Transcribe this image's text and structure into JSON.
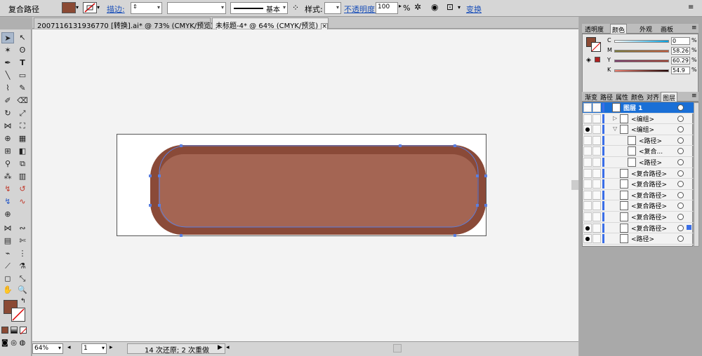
{
  "control_bar": {
    "object_type": "复合路径",
    "fill_color": "#8b4a34",
    "stroke_label": "描边:",
    "stroke_weight": "",
    "stroke_profile_label": "基本",
    "style_label": "样式:",
    "opacity_label": "不透明度:",
    "opacity_value": "100",
    "opacity_unit": "%",
    "transform_label": "变换"
  },
  "tabs": [
    {
      "title": "20071161319367​70 [转换].ai* @ 73% (CMYK/预览)",
      "active": false
    },
    {
      "title": "未标题-4* @ 64% (CMYK/预览)",
      "active": true
    }
  ],
  "artwork": {
    "outer_color": "#8a4a38",
    "inner_color": "#a46553",
    "path_color": "#5a7fe0"
  },
  "status_bar": {
    "zoom": "64%",
    "artboard_number": "1",
    "history": "14 次还原; 2 次重做"
  },
  "color_panel": {
    "tabs": [
      "透明度",
      "颜色",
      "外观",
      "画板"
    ],
    "active_tab": "颜色",
    "fill_color": "#8b4a34",
    "channels": [
      {
        "label": "C",
        "value": "0"
      },
      {
        "label": "M",
        "value": "58.26"
      },
      {
        "label": "Y",
        "value": "60.29"
      },
      {
        "label": "K",
        "value": "54.9"
      }
    ],
    "unit": "%"
  },
  "layers_panel": {
    "tabs": [
      "渐变",
      "路径",
      "属性",
      "颜色",
      "对齐",
      "图层"
    ],
    "active_tab": "图层",
    "layers": [
      {
        "name": "图层 1",
        "level": 0,
        "header": true,
        "visible": true
      },
      {
        "name": "<编组>",
        "level": 1,
        "visible": false,
        "expand": "right"
      },
      {
        "name": "<编组>",
        "level": 1,
        "visible": true,
        "expand": "down"
      },
      {
        "name": "<路径>",
        "level": 2,
        "visible": false
      },
      {
        "name": "<复合...",
        "level": 2,
        "visible": false
      },
      {
        "name": "<路径>",
        "level": 2,
        "visible": false
      },
      {
        "name": "<复合路径>",
        "level": 1,
        "visible": false
      },
      {
        "name": "<复合路径>",
        "level": 1,
        "visible": false
      },
      {
        "name": "<复合路径>",
        "level": 1,
        "visible": false
      },
      {
        "name": "<复合路径>",
        "level": 1,
        "visible": false
      },
      {
        "name": "<复合路径>",
        "level": 1,
        "visible": false
      },
      {
        "name": "<复合路径>",
        "level": 1,
        "visible": true,
        "selected": true
      },
      {
        "name": "<路径>",
        "level": 1,
        "visible": true
      }
    ]
  }
}
